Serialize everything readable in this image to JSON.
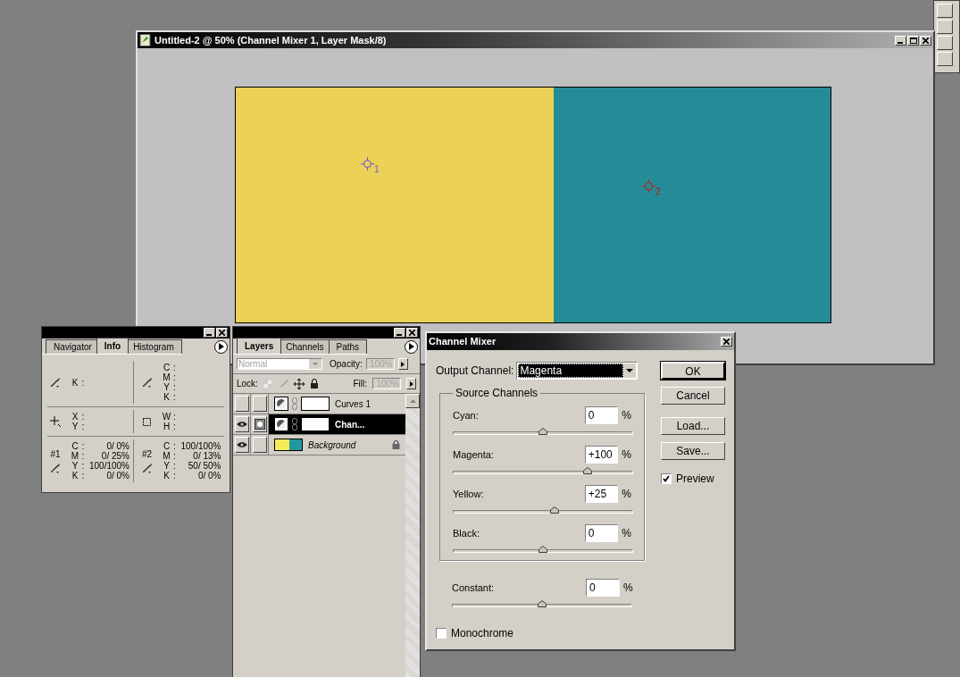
{
  "document": {
    "title": "Untitled-2 @ 50% (Channel Mixer 1, Layer Mask/8)",
    "samplers": [
      {
        "label": "1",
        "color": "#6a4fe0"
      },
      {
        "label": "2",
        "color": "#c01818"
      }
    ]
  },
  "info": {
    "tabs": [
      {
        "label": "Navigator",
        "selected": false
      },
      {
        "label": "Info",
        "selected": true
      },
      {
        "label": "Histogram",
        "selected": false
      }
    ],
    "sections": [
      {
        "cells": [
          {
            "kind": "eyedropper",
            "rows": [
              {
                "label": "K",
                "sep": ":"
              }
            ]
          },
          {
            "kind": "eyedropper",
            "rows": [
              {
                "label": "C",
                "sep": ":"
              },
              {
                "label": "M",
                "sep": ":"
              },
              {
                "label": "Y",
                "sep": ":"
              },
              {
                "label": "K",
                "sep": ":"
              }
            ]
          }
        ]
      },
      {
        "cells": [
          {
            "kind": "crosshair",
            "rows": [
              {
                "label": "X",
                "sep": ":"
              },
              {
                "label": "Y",
                "sep": ":"
              }
            ]
          },
          {
            "kind": "selection",
            "rows": [
              {
                "label": "W",
                "sep": ":"
              },
              {
                "label": "H",
                "sep": ":"
              }
            ]
          }
        ]
      },
      {
        "cells": [
          {
            "kind": "eyedropper",
            "tag": "#1",
            "rows": [
              {
                "label": "C",
                "sep": ":",
                "value": "0/ 0%"
              },
              {
                "label": "M",
                "sep": ":",
                "value": "0/ 25%"
              },
              {
                "label": "Y",
                "sep": ":",
                "value": "100/100%"
              },
              {
                "label": "K",
                "sep": ":",
                "value": "0/ 0%"
              }
            ]
          },
          {
            "kind": "eyedropper",
            "tag": "#2",
            "rows": [
              {
                "label": "C",
                "sep": ":",
                "value": "100/100%"
              },
              {
                "label": "M",
                "sep": ":",
                "value": "0/ 13%"
              },
              {
                "label": "Y",
                "sep": ":",
                "value": "50/ 50%"
              },
              {
                "label": "K",
                "sep": ":",
                "value": "0/ 0%"
              }
            ]
          }
        ]
      }
    ]
  },
  "layers_panel": {
    "tabs": [
      {
        "label": "Layers",
        "selected": true
      },
      {
        "label": "Channels",
        "selected": false
      },
      {
        "label": "Paths",
        "selected": false
      }
    ],
    "blend_mode": {
      "value": "Normal",
      "disabled": true
    },
    "opacity": {
      "label": "Opacity:",
      "value": "100%",
      "disabled": true
    },
    "lock_label": "Lock:",
    "fill": {
      "label": "Fill:",
      "value": "100%",
      "disabled": true
    },
    "layers": [
      {
        "name": "Curves 1",
        "kind": "adjustment",
        "visible": false,
        "selected": false,
        "mask_active": false,
        "locked": false
      },
      {
        "name": "Chan...",
        "kind": "adjustment",
        "visible": true,
        "selected": true,
        "mask_active": true,
        "locked": false
      },
      {
        "name": "Background",
        "kind": "image",
        "visible": true,
        "selected": false,
        "mask_active": false,
        "locked": true
      }
    ]
  },
  "channel_mixer": {
    "title": "Channel Mixer",
    "output_label": "Output Channel:",
    "output_value": "Magenta",
    "group_title": "Source Channels",
    "sources": [
      {
        "label": "Cyan:",
        "value": "0",
        "unit": "%",
        "level": 0.5
      },
      {
        "label": "Magenta:",
        "value": "+100",
        "unit": "%",
        "level": 0.75
      },
      {
        "label": "Yellow:",
        "value": "+25",
        "unit": "%",
        "level": 0.5625
      },
      {
        "label": "Black:",
        "value": "0",
        "unit": "%",
        "level": 0.5
      }
    ],
    "constant": {
      "label": "Constant:",
      "value": "0",
      "unit": "%",
      "level": 0.5
    },
    "buttons": [
      "OK",
      "Cancel",
      "Load...",
      "Save..."
    ],
    "preview": {
      "label": "Preview",
      "checked": true
    },
    "monochrome": {
      "label": "Monochrome",
      "checked": false
    }
  }
}
